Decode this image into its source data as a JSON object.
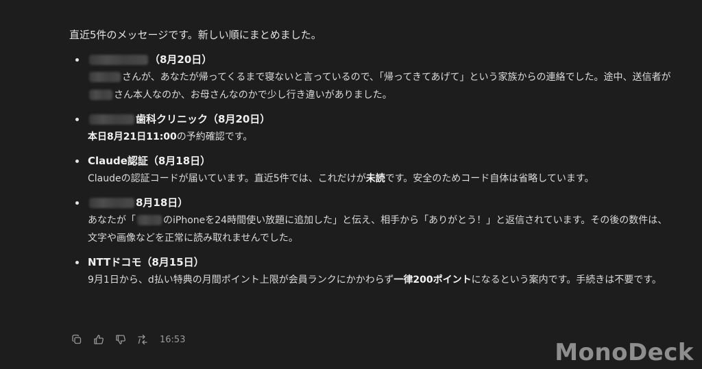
{
  "intro": "直近5件のメッセージです。新しい順にまとめました。",
  "messages": [
    {
      "head": "（8月20日）",
      "body": [
        {
          "t": "blur",
          "w": 46
        },
        {
          "t": "text",
          "v": "さんが、あなたが帰ってくるまで寝ないと言っているので、「帰ってきてあげて」という家族からの連絡でした。途中、送信者が"
        },
        {
          "t": "blur",
          "w": 34
        },
        {
          "t": "text",
          "v": "さん本人なのか、お母さんなのかで少し行き違いがありました。"
        }
      ]
    },
    {
      "head": "歯科クリニック（8月20日）",
      "body": [
        {
          "t": "bold",
          "v": "本日8月21日11:00"
        },
        {
          "t": "text",
          "v": "の予約確認です。"
        }
      ]
    },
    {
      "head": "Claude認証（8月18日）",
      "body": [
        {
          "t": "text",
          "v": "Claudeの認証コードが届いています。直近5件では、これだけが"
        },
        {
          "t": "bold",
          "v": "未読"
        },
        {
          "t": "text",
          "v": "です。安全のためコード自体は省略しています。"
        }
      ]
    },
    {
      "head": "8月18日）",
      "body": [
        {
          "t": "text",
          "v": "あなたが「"
        },
        {
          "t": "blur",
          "w": 36
        },
        {
          "t": "text",
          "v": "のiPhoneを24時間使い放題に追加した」と伝え、相手から「ありがとう！」と返信されています。その後の数件は、文字や画像などを正常に読み取れませんでした。"
        }
      ]
    },
    {
      "head": "NTTドコモ（8月15日）",
      "body": [
        {
          "t": "text",
          "v": "9月1日から、d払い特典の月間ポイント上限が会員ランクにかかわらず"
        },
        {
          "t": "bold",
          "v": "一律200ポイント"
        },
        {
          "t": "text",
          "v": "になるという案内です。手続きは不要です。"
        }
      ]
    }
  ],
  "head_blur_widths": [
    86,
    66,
    0,
    66,
    0
  ],
  "toolbar": {
    "icons": [
      "copy-icon",
      "thumbs-up-icon",
      "thumbs-down-icon",
      "retry-icon"
    ],
    "time": "16:53"
  },
  "watermark": "MonoDeck"
}
